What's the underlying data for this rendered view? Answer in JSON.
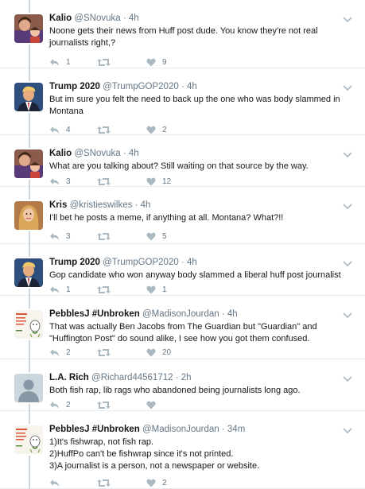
{
  "colors": {
    "text": "#14171a",
    "muted": "#657786",
    "icon": "#aab8c2",
    "thread_line": "#ccd6dd",
    "divider": "#e6ecf0"
  },
  "tweets": [
    {
      "name": "Kalio",
      "handle": "@SNovuka",
      "time": "4h",
      "text": "Noone gets their news from Huff post dude. You know they're not real journalists right,?",
      "replies": "1",
      "retweets": "",
      "likes": "9",
      "avatar": "photo-woman-child"
    },
    {
      "name": "Trump 2020",
      "handle": "@TrumpGOP2020",
      "time": "4h",
      "text": "But im sure you felt the need to back up the one who was body slammed in Montana",
      "replies": "4",
      "retweets": "",
      "likes": "2",
      "avatar": "photo-man-suit"
    },
    {
      "name": "Kalio",
      "handle": "@SNovuka",
      "time": "4h",
      "text": "What are you talking about? Still waiting on that source by the way.",
      "replies": "3",
      "retweets": "",
      "likes": "12",
      "avatar": "photo-woman-child"
    },
    {
      "name": "Kris",
      "handle": "@kristieswilkes",
      "time": "4h",
      "text": "I'll bet he posts a meme, if anything at all. Montana? What?!!",
      "replies": "3",
      "retweets": "",
      "likes": "5",
      "avatar": "photo-woman-blonde"
    },
    {
      "name": "Trump 2020",
      "handle": "@TrumpGOP2020",
      "time": "4h",
      "text": "Gop candidate who won anyway body slammed a liberal huff post journalist",
      "replies": "1",
      "retweets": "",
      "likes": "1",
      "avatar": "photo-man-suit"
    },
    {
      "name": "PebblesJ #Unbroken",
      "handle": "@MadisonJourdan",
      "time": "4h",
      "text": "That was actually Ben Jacobs from The Guardian but \"Guardian\" and \"Huffington Post\" do sound alike, I see how you got them confused.",
      "replies": "2",
      "retweets": "",
      "likes": "20",
      "avatar": "drawing-card"
    },
    {
      "name": "L.A. Rich",
      "handle": "@Richard44561712",
      "time": "2h",
      "text": "Both fish rap, lib rags who abandoned being journalists long ago.",
      "replies": "2",
      "retweets": "",
      "likes": "",
      "avatar": "default-egg"
    },
    {
      "name": "PebblesJ #Unbroken",
      "handle": "@MadisonJourdan",
      "time": "34m",
      "text": "1)It's fishwrap, not fish rap.\n2)HuffPo can't be fishwrap since it's not printed.\n3)A journalist is a person, not a newspaper or website.",
      "replies": "",
      "retweets": "",
      "likes": "2",
      "avatar": "drawing-card"
    }
  ]
}
